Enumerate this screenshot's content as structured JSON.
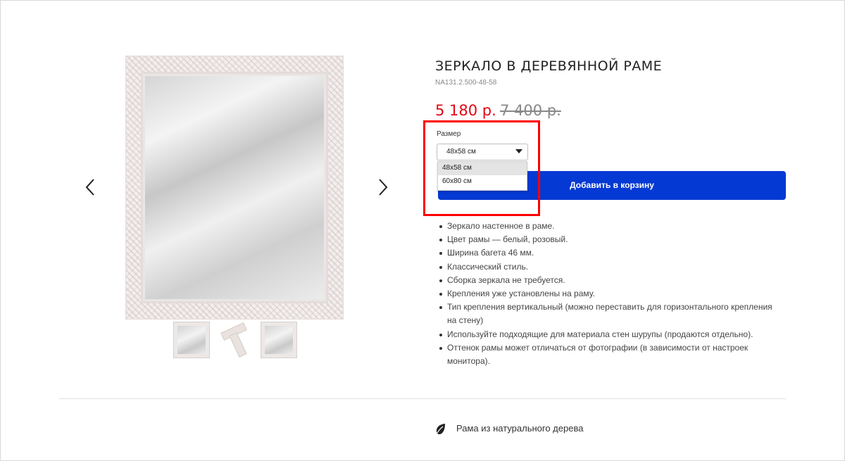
{
  "gallery": {
    "prev_icon": "chevron-left-icon",
    "next_icon": "chevron-right-icon",
    "thumbnails": [
      "mirror-front",
      "frame-corner",
      "mirror-angle"
    ]
  },
  "product": {
    "title": "ЗЕРКАЛО В ДЕРЕВЯННОЙ РАМЕ",
    "sku": "NA131.2.500-48-58",
    "price": "5 180 р.",
    "old_price": "7 400 р.",
    "price_color": "#e30613"
  },
  "size_select": {
    "label": "Размер",
    "value": "48x58 см",
    "options": [
      "48x58 см",
      "60x80 см"
    ]
  },
  "cart_button": {
    "label": "Добавить в корзину",
    "color": "#0539d3"
  },
  "features": [
    "Зеркало настенное в раме.",
    "Цвет рамы — белый, розовый.",
    "Ширина багета 46 мм.",
    "Классический стиль.",
    "Сборка зеркала не требуется.",
    "Крепления уже установлены на раму.",
    "Тип крепления вертикальный (можно переставить для горизонтального крепления на стену)",
    "Используйте подходящие для материала стен шурупы (продаются отдельно).",
    "Оттенок рамы может отличаться от фотографии (в зависимости от настроек монитора)."
  ],
  "footer_note": {
    "icon": "leaf-icon",
    "text": "Рама из натурального дерева"
  },
  "highlight_color": "#ff0000"
}
